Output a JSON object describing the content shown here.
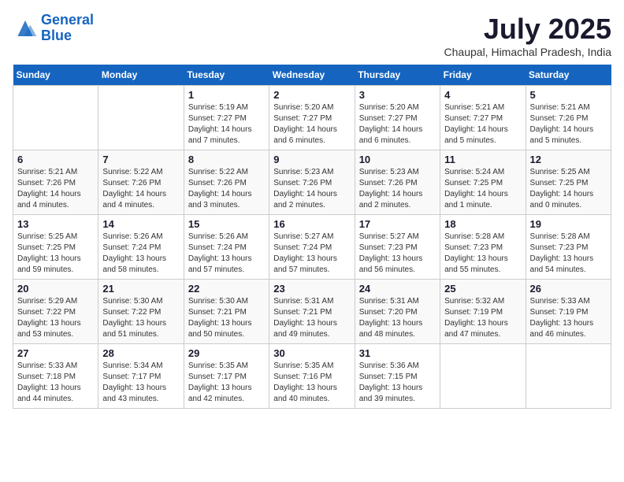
{
  "header": {
    "logo_line1": "General",
    "logo_line2": "Blue",
    "month_title": "July 2025",
    "location": "Chaupal, Himachal Pradesh, India"
  },
  "days_of_week": [
    "Sunday",
    "Monday",
    "Tuesday",
    "Wednesday",
    "Thursday",
    "Friday",
    "Saturday"
  ],
  "weeks": [
    [
      {
        "day": "",
        "detail": ""
      },
      {
        "day": "",
        "detail": ""
      },
      {
        "day": "1",
        "detail": "Sunrise: 5:19 AM\nSunset: 7:27 PM\nDaylight: 14 hours and 7 minutes."
      },
      {
        "day": "2",
        "detail": "Sunrise: 5:20 AM\nSunset: 7:27 PM\nDaylight: 14 hours and 6 minutes."
      },
      {
        "day": "3",
        "detail": "Sunrise: 5:20 AM\nSunset: 7:27 PM\nDaylight: 14 hours and 6 minutes."
      },
      {
        "day": "4",
        "detail": "Sunrise: 5:21 AM\nSunset: 7:27 PM\nDaylight: 14 hours and 5 minutes."
      },
      {
        "day": "5",
        "detail": "Sunrise: 5:21 AM\nSunset: 7:26 PM\nDaylight: 14 hours and 5 minutes."
      }
    ],
    [
      {
        "day": "6",
        "detail": "Sunrise: 5:21 AM\nSunset: 7:26 PM\nDaylight: 14 hours and 4 minutes."
      },
      {
        "day": "7",
        "detail": "Sunrise: 5:22 AM\nSunset: 7:26 PM\nDaylight: 14 hours and 4 minutes."
      },
      {
        "day": "8",
        "detail": "Sunrise: 5:22 AM\nSunset: 7:26 PM\nDaylight: 14 hours and 3 minutes."
      },
      {
        "day": "9",
        "detail": "Sunrise: 5:23 AM\nSunset: 7:26 PM\nDaylight: 14 hours and 2 minutes."
      },
      {
        "day": "10",
        "detail": "Sunrise: 5:23 AM\nSunset: 7:26 PM\nDaylight: 14 hours and 2 minutes."
      },
      {
        "day": "11",
        "detail": "Sunrise: 5:24 AM\nSunset: 7:25 PM\nDaylight: 14 hours and 1 minute."
      },
      {
        "day": "12",
        "detail": "Sunrise: 5:25 AM\nSunset: 7:25 PM\nDaylight: 14 hours and 0 minutes."
      }
    ],
    [
      {
        "day": "13",
        "detail": "Sunrise: 5:25 AM\nSunset: 7:25 PM\nDaylight: 13 hours and 59 minutes."
      },
      {
        "day": "14",
        "detail": "Sunrise: 5:26 AM\nSunset: 7:24 PM\nDaylight: 13 hours and 58 minutes."
      },
      {
        "day": "15",
        "detail": "Sunrise: 5:26 AM\nSunset: 7:24 PM\nDaylight: 13 hours and 57 minutes."
      },
      {
        "day": "16",
        "detail": "Sunrise: 5:27 AM\nSunset: 7:24 PM\nDaylight: 13 hours and 57 minutes."
      },
      {
        "day": "17",
        "detail": "Sunrise: 5:27 AM\nSunset: 7:23 PM\nDaylight: 13 hours and 56 minutes."
      },
      {
        "day": "18",
        "detail": "Sunrise: 5:28 AM\nSunset: 7:23 PM\nDaylight: 13 hours and 55 minutes."
      },
      {
        "day": "19",
        "detail": "Sunrise: 5:28 AM\nSunset: 7:23 PM\nDaylight: 13 hours and 54 minutes."
      }
    ],
    [
      {
        "day": "20",
        "detail": "Sunrise: 5:29 AM\nSunset: 7:22 PM\nDaylight: 13 hours and 53 minutes."
      },
      {
        "day": "21",
        "detail": "Sunrise: 5:30 AM\nSunset: 7:22 PM\nDaylight: 13 hours and 51 minutes."
      },
      {
        "day": "22",
        "detail": "Sunrise: 5:30 AM\nSunset: 7:21 PM\nDaylight: 13 hours and 50 minutes."
      },
      {
        "day": "23",
        "detail": "Sunrise: 5:31 AM\nSunset: 7:21 PM\nDaylight: 13 hours and 49 minutes."
      },
      {
        "day": "24",
        "detail": "Sunrise: 5:31 AM\nSunset: 7:20 PM\nDaylight: 13 hours and 48 minutes."
      },
      {
        "day": "25",
        "detail": "Sunrise: 5:32 AM\nSunset: 7:19 PM\nDaylight: 13 hours and 47 minutes."
      },
      {
        "day": "26",
        "detail": "Sunrise: 5:33 AM\nSunset: 7:19 PM\nDaylight: 13 hours and 46 minutes."
      }
    ],
    [
      {
        "day": "27",
        "detail": "Sunrise: 5:33 AM\nSunset: 7:18 PM\nDaylight: 13 hours and 44 minutes."
      },
      {
        "day": "28",
        "detail": "Sunrise: 5:34 AM\nSunset: 7:17 PM\nDaylight: 13 hours and 43 minutes."
      },
      {
        "day": "29",
        "detail": "Sunrise: 5:35 AM\nSunset: 7:17 PM\nDaylight: 13 hours and 42 minutes."
      },
      {
        "day": "30",
        "detail": "Sunrise: 5:35 AM\nSunset: 7:16 PM\nDaylight: 13 hours and 40 minutes."
      },
      {
        "day": "31",
        "detail": "Sunrise: 5:36 AM\nSunset: 7:15 PM\nDaylight: 13 hours and 39 minutes."
      },
      {
        "day": "",
        "detail": ""
      },
      {
        "day": "",
        "detail": ""
      }
    ]
  ]
}
